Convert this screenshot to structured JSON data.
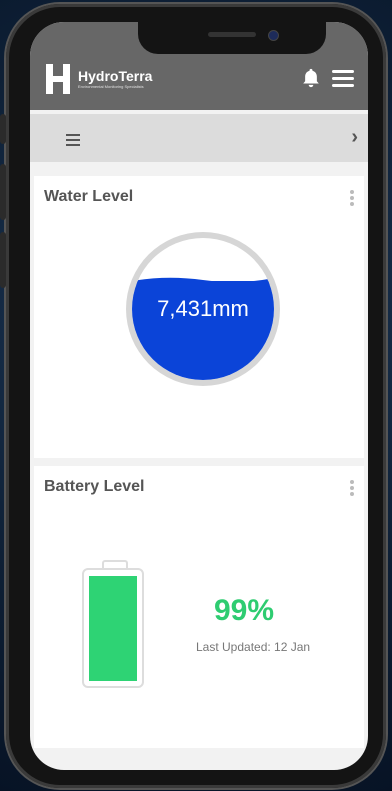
{
  "app": {
    "brand_name": "HydroTerra",
    "brand_tagline": "Environmental Monitoring Specialists",
    "header_color": "#676767"
  },
  "icons": {
    "bell": "bell-icon",
    "menu": "menu-icon",
    "subbar_menu": "list-icon",
    "next": "chevron-right-icon",
    "more": "kebab-icon"
  },
  "subbar": {
    "next_glyph": "›"
  },
  "water_card": {
    "title": "Water Level",
    "value": "7,431mm",
    "fill_fraction": 0.7,
    "fill_color": "#0b44d8"
  },
  "battery_card": {
    "title": "Battery Level",
    "percent": "99%",
    "level_fraction": 0.99,
    "updated": "Last Updated: 12 Jan",
    "fill_color": "#2ed374",
    "percent_color": "#2ecc71"
  }
}
